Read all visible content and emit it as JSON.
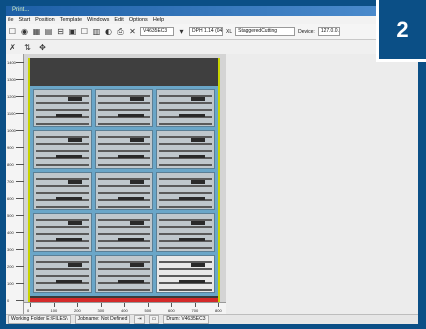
{
  "window": {
    "title": "Print..."
  },
  "menu": [
    "ile",
    "Start",
    "Position",
    "Template",
    "Windows",
    "Edit",
    "Options",
    "Help"
  ],
  "toolbar": {
    "template_select": "V4635EC3",
    "dpi_select": "DPH 1.14 (045)",
    "xl_label": "XL",
    "layout_select": "StaggeredCutting",
    "device_label": "Device:",
    "device_value": "127.0.0.1"
  },
  "badge": {
    "number": "2"
  },
  "rulers": {
    "vertical": [
      "1400",
      "1300",
      "1200",
      "1100",
      "1000",
      "900",
      "800",
      "700",
      "600",
      "500",
      "400",
      "300",
      "200",
      "100",
      "0"
    ],
    "horizontal": [
      "0",
      "100",
      "200",
      "300",
      "400",
      "500",
      "600",
      "700",
      "800"
    ]
  },
  "status": {
    "folder": "Working Folder E:\\FILES\\",
    "jobname": "Jobname: Not Defined",
    "drum": "Drum: V4635EC3"
  },
  "colors": {
    "frame": "#0b4f86",
    "sheet_edge": "#c8d400",
    "bottom_bar": "#d42a2a",
    "grid_bg": "#6aa6c8"
  }
}
